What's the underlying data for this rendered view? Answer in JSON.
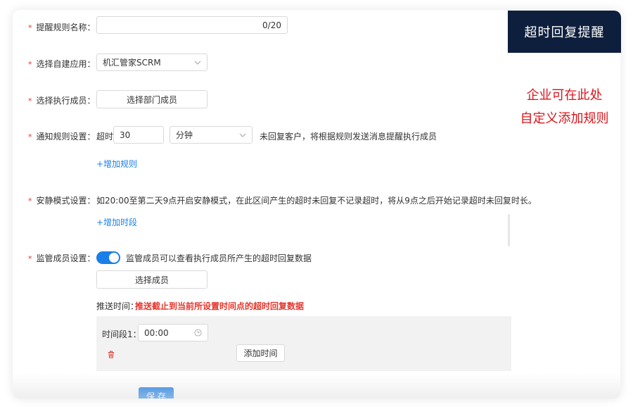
{
  "form": {
    "rule_name": {
      "label": "提醒规则名称：",
      "counter": "0/20",
      "value": ""
    },
    "app": {
      "label": "选择自建应用：",
      "selected": "机汇管家SCRM"
    },
    "executor": {
      "label": "选择执行成员：",
      "button": "选择部门成员"
    },
    "notify": {
      "label": "通知规则设置：",
      "prefix": "超时",
      "value": "30",
      "unit": "分钟",
      "suffix": "未回复客户，将根据规则发送消息提醒执行成员",
      "add_rule": "+增加规则"
    },
    "quiet": {
      "label": "安静模式设置：",
      "description": "如20:00至第二天9点开启安静模式，在此区间产生的超时未回复不记录超时，将从9点之后开始记录超时未回复时长。",
      "add_period": "+增加时段"
    },
    "supervisor": {
      "label": "监管成员设置：",
      "toggle_on": true,
      "toggle_text": "监管成员可以查看执行成员所产生的超时回复数据",
      "select_button": "选择成员",
      "push_label": "推送时间：",
      "push_note": "推送截止到当前所设置时间点的超时回复数据",
      "period_label": "时间段1：",
      "period_value": "00:00",
      "add_time_button": "添加时间"
    },
    "save_button": "保 存"
  },
  "overlay": {
    "badge": "超时回复提醒",
    "annotation_line1": "企业可在此处",
    "annotation_line2": "自定义添加规则"
  },
  "colors": {
    "primary": "#1a7fe8",
    "required": "#e5352d",
    "badge_bg": "#0e1f3d",
    "annotation": "#d9141b"
  },
  "icons": [
    "chevron-down-icon",
    "clock-icon",
    "trash-icon"
  ]
}
